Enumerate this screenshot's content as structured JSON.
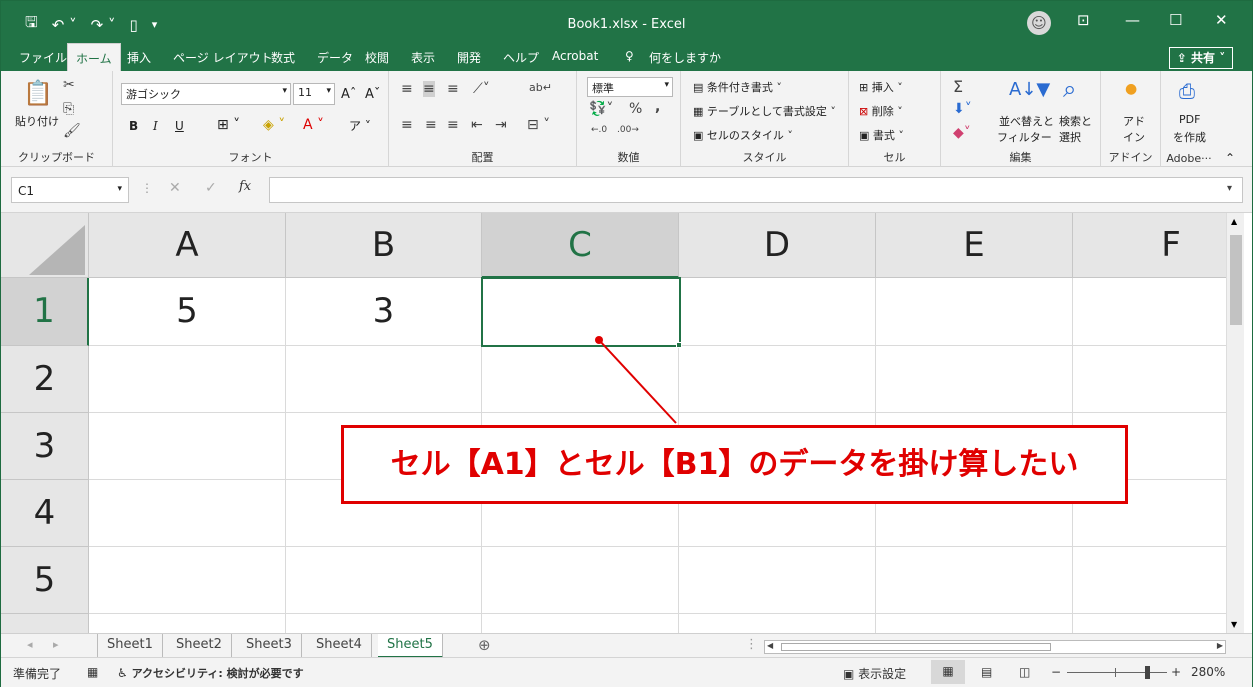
{
  "titlebar": {
    "title": "Book1.xlsx  -  Excel",
    "qat_icons": [
      "save-icon",
      "undo-icon",
      "redo-icon",
      "new-file-icon",
      "customize-qat-icon"
    ],
    "minimize": "—",
    "restore": "☐",
    "close": "✕",
    "ribbon_display": "⊡"
  },
  "tabs": {
    "items": [
      "ファイル",
      "ホーム",
      "挿入",
      "ページ レイアウト",
      "数式",
      "データ",
      "校閲",
      "表示",
      "開発",
      "ヘルプ",
      "Acrobat"
    ],
    "active": "ホーム",
    "tell_me": "何をしますか",
    "share": "共有"
  },
  "ribbon": {
    "clipboard": {
      "paste": "貼り付け",
      "label": "クリップボード"
    },
    "font": {
      "name": "游ゴシック",
      "size": "11",
      "bold": "B",
      "italic": "I",
      "underline": "U",
      "label": "フォント"
    },
    "alignment": {
      "label": "配置"
    },
    "number": {
      "format": "標準",
      "percent": "%",
      "comma": ",",
      "label": "数値"
    },
    "styles": {
      "conditional": "条件付き書式",
      "table": "テーブルとして書式設定",
      "cell_styles": "セルのスタイル",
      "label": "スタイル"
    },
    "cells": {
      "insert": "挿入",
      "delete": "削除",
      "format": "書式",
      "label": "セル"
    },
    "editing": {
      "sum": "Σ",
      "sort_filter_1": "並べ替えと",
      "sort_filter_2": "フィルター",
      "find_select_1": "検索と",
      "find_select_2": "選択",
      "label": "編集"
    },
    "addins": {
      "addin_1": "アド",
      "addin_2": "イン",
      "label": "アドイン"
    },
    "adobe": {
      "pdf_1": "PDF",
      "pdf_2": "を作成",
      "label": "Adobe···"
    }
  },
  "formula_bar": {
    "name_box": "C1",
    "fx": "fx",
    "cancel": "✕",
    "enter": "✓",
    "value": ""
  },
  "sheet": {
    "columns": [
      "A",
      "B",
      "C",
      "D",
      "E",
      "F"
    ],
    "selected_column": "C",
    "rows": [
      "1",
      "2",
      "3",
      "4",
      "5"
    ],
    "selected_row": "1",
    "cells": {
      "A1": "5",
      "B1": "3",
      "C1": ""
    }
  },
  "callout": {
    "text": "セル【A1】とセル【B1】のデータを掛け算したい"
  },
  "sheet_tabs": {
    "items": [
      "Sheet1",
      "Sheet2",
      "Sheet3",
      "Sheet4",
      "Sheet5"
    ],
    "active": "Sheet5"
  },
  "status": {
    "ready": "準備完了",
    "accessibility": "アクセシビリティ: 検討が必要です",
    "display_settings": "表示設定",
    "zoom": "280%"
  }
}
